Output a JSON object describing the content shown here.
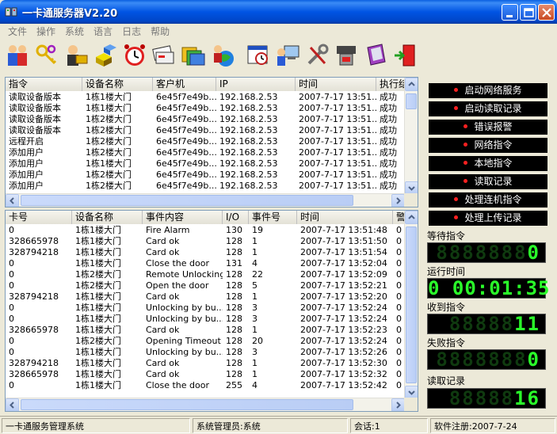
{
  "window": {
    "title": "一卡通服务器V2.20"
  },
  "menu": [
    "文件",
    "操作",
    "系统",
    "语言",
    "日志",
    "帮助"
  ],
  "toolbar_icons": [
    "users-icon",
    "keys-icon",
    "card-key-icon",
    "boxes-icon",
    "alarm-clock-icon",
    "cards-stack-icon",
    "folders-icon",
    "globe-user-icon",
    "schedule-icon",
    "user-computer-icon",
    "tools-icon",
    "machine-icon",
    "book-icon",
    "exit-door-icon"
  ],
  "command_log": {
    "columns": [
      "指令",
      "设备名称",
      "客户机",
      "IP",
      "时间",
      "执行结"
    ],
    "rows": [
      [
        "读取设备版本",
        "1栋1楼大门",
        "6e45f7e49b...",
        "192.168.2.53",
        "2007-7-17 13:51...",
        "成功"
      ],
      [
        "读取设备版本",
        "1栋1楼大门",
        "6e45f7e49b...",
        "192.168.2.53",
        "2007-7-17 13:51...",
        "成功"
      ],
      [
        "读取设备版本",
        "1栋2楼大门",
        "6e45f7e49b...",
        "192.168.2.53",
        "2007-7-17 13:51...",
        "成功"
      ],
      [
        "读取设备版本",
        "1栋2楼大门",
        "6e45f7e49b...",
        "192.168.2.53",
        "2007-7-17 13:51...",
        "成功"
      ],
      [
        "远程开启",
        "1栋2楼大门",
        "6e45f7e49b...",
        "192.168.2.53",
        "2007-7-17 13:51...",
        "成功"
      ],
      [
        "添加用户",
        "1栋2楼大门",
        "6e45f7e49b...",
        "192.168.2.53",
        "2007-7-17 13:51...",
        "成功"
      ],
      [
        "添加用户",
        "1栋1楼大门",
        "6e45f7e49b...",
        "192.168.2.53",
        "2007-7-17 13:51...",
        "成功"
      ],
      [
        "添加用户",
        "1栋2楼大门",
        "6e45f7e49b...",
        "192.168.2.53",
        "2007-7-17 13:51...",
        "成功"
      ],
      [
        "添加用户",
        "1栋2楼大门",
        "6e45f7e49b...",
        "192.168.2.53",
        "2007-7-17 13:51...",
        "成功"
      ]
    ]
  },
  "event_log": {
    "columns": [
      "卡号",
      "设备名称",
      "事件内容",
      "I/O",
      "事件号",
      "时间",
      "警"
    ],
    "rows": [
      [
        "0",
        "1栋1楼大门",
        "Fire Alarm",
        "130",
        "19",
        "2007-7-17 13:51:48",
        "0"
      ],
      [
        "328665978",
        "1栋1楼大门",
        "Card ok",
        "128",
        "1",
        "2007-7-17 13:51:50",
        "0"
      ],
      [
        "328794218",
        "1栋1楼大门",
        "Card ok",
        "128",
        "1",
        "2007-7-17 13:51:54",
        "0"
      ],
      [
        "0",
        "1栋1楼大门",
        "Close the door",
        "131",
        "4",
        "2007-7-17 13:52:04",
        "0"
      ],
      [
        "0",
        "1栋2楼大门",
        "Remote Unlocking",
        "128",
        "22",
        "2007-7-17 13:52:09",
        "0"
      ],
      [
        "0",
        "1栋2楼大门",
        "Open the door",
        "128",
        "5",
        "2007-7-17 13:52:21",
        "0"
      ],
      [
        "328794218",
        "1栋1楼大门",
        "Card ok",
        "128",
        "1",
        "2007-7-17 13:52:20",
        "0"
      ],
      [
        "0",
        "1栋1楼大门",
        "Unlocking by bu...",
        "128",
        "3",
        "2007-7-17 13:52:24",
        "0"
      ],
      [
        "0",
        "1栋1楼大门",
        "Unlocking by bu...",
        "128",
        "3",
        "2007-7-17 13:52:24",
        "0"
      ],
      [
        "328665978",
        "1栋1楼大门",
        "Card ok",
        "128",
        "1",
        "2007-7-17 13:52:23",
        "0"
      ],
      [
        "0",
        "1栋2楼大门",
        "Opening Timeout",
        "128",
        "20",
        "2007-7-17 13:52:24",
        "0"
      ],
      [
        "0",
        "1栋1楼大门",
        "Unlocking by bu...",
        "128",
        "3",
        "2007-7-17 13:52:26",
        "0"
      ],
      [
        "328794218",
        "1栋1楼大门",
        "Card ok",
        "128",
        "1",
        "2007-7-17 13:52:30",
        "0"
      ],
      [
        "328665978",
        "1栋1楼大门",
        "Card ok",
        "128",
        "1",
        "2007-7-17 13:52:32",
        "0"
      ],
      [
        "0",
        "1栋1楼大门",
        "Close the door",
        "255",
        "4",
        "2007-7-17 13:52:42",
        "0"
      ]
    ]
  },
  "side_buttons": [
    "启动网络服务",
    "启动读取记录",
    "错误报警",
    "网络指令",
    "本地指令",
    "读取记录",
    "处理连机指令",
    "处理上传记录"
  ],
  "counters": [
    {
      "label": "等待指令",
      "value": "0",
      "ghost": "8888888"
    },
    {
      "label": "运行时间",
      "value": "0 00:01:35",
      "ghost": ""
    },
    {
      "label": "收到指令",
      "value": "11",
      "ghost": "88888"
    },
    {
      "label": "失败指令",
      "value": "0",
      "ghost": "8888888"
    },
    {
      "label": "读取记录",
      "value": "16",
      "ghost": "88888"
    }
  ],
  "status": {
    "system": "一卡通服务管理系统",
    "admin": "系统管理员:系统",
    "session": "会话:1",
    "registration": "软件注册:2007-7-24"
  },
  "colors": {
    "title_blue": "#0054E3",
    "lcd_green": "#2AFF2A",
    "indicator_red": "#FF2020"
  }
}
